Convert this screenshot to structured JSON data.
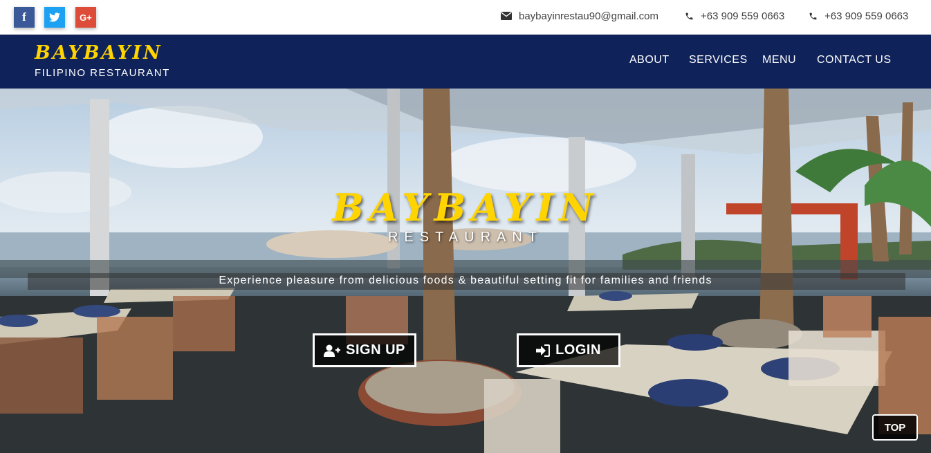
{
  "topbar": {
    "social": [
      {
        "name": "facebook-icon",
        "glyph": "f",
        "color": "#3b5998"
      },
      {
        "name": "twitter-icon",
        "glyph": "twitter",
        "color": "#1da1f2"
      },
      {
        "name": "google-plus-icon",
        "glyph": "G+",
        "color": "#dd4b39"
      }
    ],
    "email": "baybayinrestau90@gmail.com",
    "phone1": "+63 909 559 0663",
    "phone2": "+63 909 559 0663"
  },
  "navbar": {
    "brand_title": "BAYBAYIN",
    "brand_subtitle": "FILIPINO RESTAURANT",
    "links": [
      "ABOUT",
      "SERVICES",
      "MENU",
      "CONTACT US"
    ],
    "background_color": "#0f2259",
    "brand_color": "#ffd400"
  },
  "hero": {
    "title": "BAYBAYIN",
    "subtitle": "RESTAURANT",
    "tagline": "Experience pleasure from delicious foods & beautiful setting fit for families and friends",
    "signup_label": "SIGN UP",
    "login_label": "LOGIN",
    "top_label": "TOP",
    "signup_icon": "user-plus-icon",
    "login_icon": "sign-in-icon"
  }
}
